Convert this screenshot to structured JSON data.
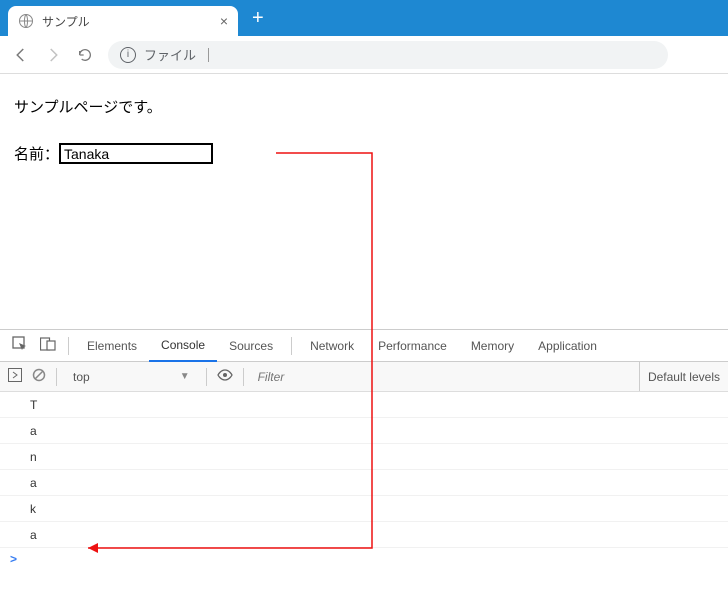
{
  "titlebar": {
    "tab_title": "サンプル",
    "new_tab": "+"
  },
  "addressbar": {
    "url_text": "ファイル",
    "separator": "|"
  },
  "page": {
    "text_line1": "サンプルページです。",
    "label_name": "名前：",
    "input_value": "Tanaka"
  },
  "devtools": {
    "tabs": [
      "Elements",
      "Console",
      "Sources",
      "Network",
      "Performance",
      "Memory",
      "Application"
    ],
    "active_tab": "Console",
    "context": "top",
    "filter_placeholder": "Filter",
    "levels_label": "Default levels",
    "console_output": [
      "T",
      "a",
      "n",
      "a",
      "k",
      "a"
    ],
    "prompt": ">"
  }
}
